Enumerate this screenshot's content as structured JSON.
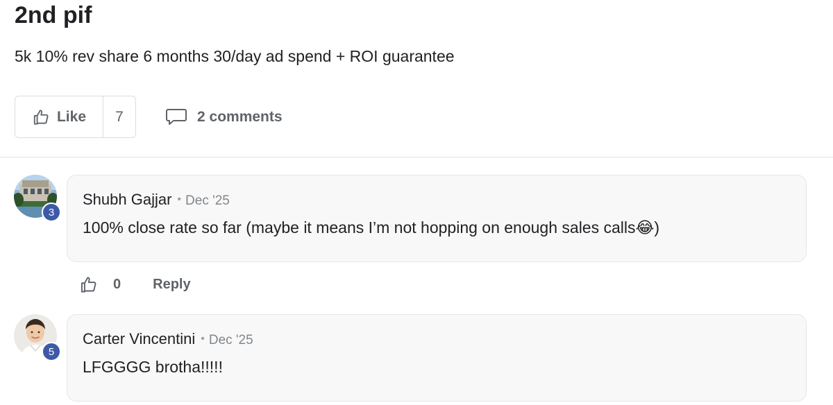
{
  "post": {
    "title": "2nd pif",
    "body": "5k 10% rev share 6 months 30/day ad spend + ROI guarantee"
  },
  "actions": {
    "like_label": "Like",
    "like_count": "7",
    "comments_label": "2 comments",
    "icons": {
      "like": "thumbs-up-icon",
      "comments": "speech-bubble-icon"
    }
  },
  "comments": [
    {
      "author": "Shubh Gajjar",
      "separator": "•",
      "date": "Dec '25",
      "text": "100% close rate so far (maybe it means I’m not hopping on enough sales calls😂)",
      "level": "3",
      "avatar": "building-photo-avatar",
      "like_count": "0",
      "reply_label": "Reply"
    },
    {
      "author": "Carter Vincentini",
      "separator": "•",
      "date": "Dec '25",
      "text": "LFGGGG brotha!!!!!",
      "level": "5",
      "avatar": "person-photo-avatar"
    }
  ],
  "colors": {
    "badge": "#3c5aa6",
    "bubble_bg": "#f8f8f8",
    "muted_text": "#5f6368"
  }
}
